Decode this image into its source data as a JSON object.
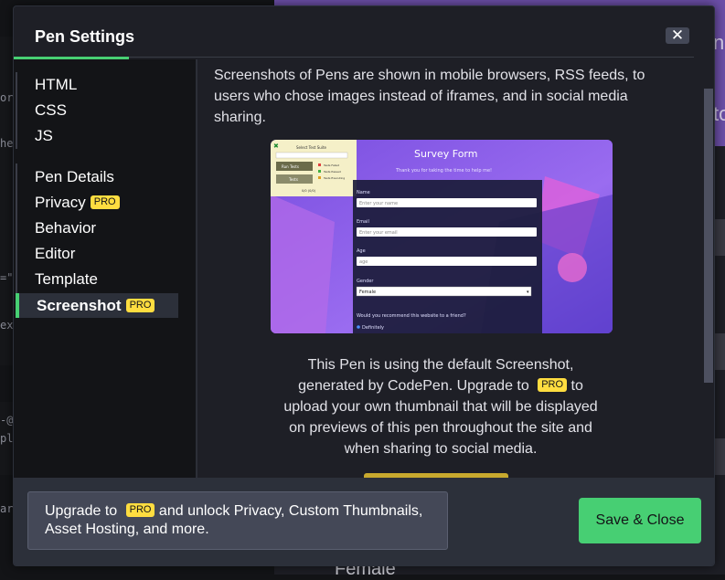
{
  "background": {
    "code_fragments": [
      "or",
      "he",
      "=\"",
      "ex",
      "-@",
      "pl",
      "ar"
    ],
    "preview_text": "Female",
    "preview_letters": [
      "n",
      "to"
    ]
  },
  "modal": {
    "title": "Pen Settings",
    "close_icon": "close-icon"
  },
  "sidebar": {
    "group1": [
      {
        "label": "HTML"
      },
      {
        "label": "CSS"
      },
      {
        "label": "JS"
      }
    ],
    "group2": [
      {
        "label": "Pen Details",
        "pro": ""
      },
      {
        "label": "Privacy",
        "pro": "PRO"
      },
      {
        "label": "Behavior",
        "pro": ""
      },
      {
        "label": "Editor",
        "pro": ""
      },
      {
        "label": "Template",
        "pro": ""
      },
      {
        "label": "Screenshot",
        "pro": "PRO",
        "active": true
      }
    ]
  },
  "content": {
    "intro": "Screenshots of Pens are shown in mobile browsers, RSS feeds, to users who chose images instead of iframes, and in social media sharing.",
    "thumbnail": {
      "test_suite_title": "Select Test Suite",
      "run_tests": "Run Tests",
      "tests": "Tests",
      "legend": [
        "Tests Failed",
        "Tests Passed",
        "Tests Executing"
      ],
      "score": "0/0 (0/0)",
      "form_title": "Survey Form",
      "form_subtitle": "Thank you for taking the time to help me!",
      "name_label": "Name",
      "name_placeholder": "Enter your name",
      "email_label": "Email",
      "email_placeholder": "Enter your email",
      "age_label": "Age",
      "age_placeholder": "age",
      "gender_label": "Gender",
      "gender_value": "Female",
      "recommend_question": "Would you recommend this website to a friend?",
      "recommend_option": "Definitely"
    },
    "desc_part1": "This Pen is using the default Screenshot, generated by CodePen. Upgrade to",
    "desc_pro": "PRO",
    "desc_part2": "to upload your own thumbnail that will be displayed on previews of this pen throughout the site and when sharing to social media."
  },
  "footer": {
    "upgrade_part1": "Upgrade to",
    "upgrade_pro": "PRO",
    "upgrade_part2": "and unlock Privacy, Custom Thumbnails, Asset Hosting, and more.",
    "save_label": "Save & Close"
  },
  "colors": {
    "accent_green": "#47cf73",
    "pro_yellow": "#ffdd40",
    "modal_bg": "#1e1f26",
    "sidebar_bg": "#131417",
    "footer_bg": "#2c303a"
  }
}
